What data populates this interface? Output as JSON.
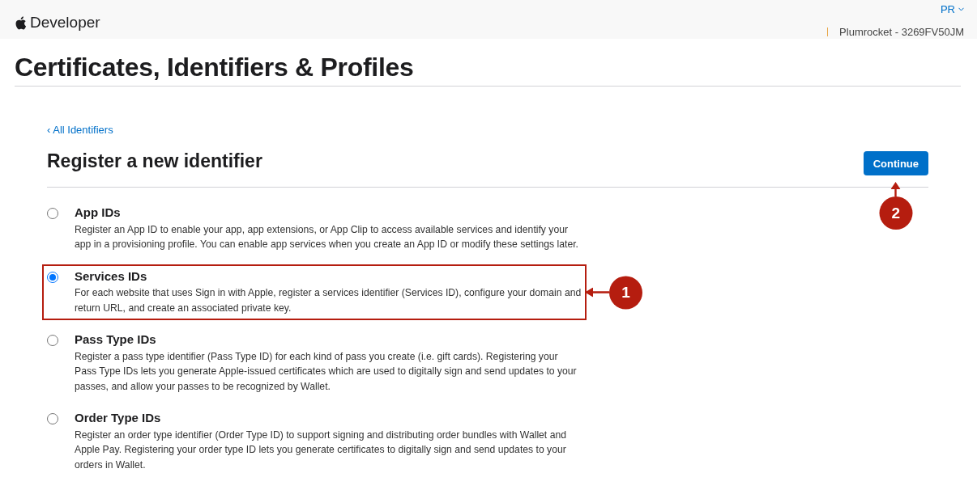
{
  "header": {
    "brand": "Developer",
    "account_initials": "PR",
    "team": "Plumrocket - 3269FV50JM"
  },
  "page_title": "Certificates, Identifiers & Profiles",
  "back_link": "‹ All Identifiers",
  "heading": "Register a new identifier",
  "continue_button": {
    "label": "Continue",
    "callout": "2"
  },
  "options": [
    {
      "title": "App IDs",
      "description": "Register an App ID to enable your app, app extensions, or App Clip to access available services and identify your app in a provisioning profile. You can enable app services when you create an App ID or modify these settings later.",
      "selected": false,
      "highlighted": false
    },
    {
      "title": "Services IDs",
      "description": "For each website that uses Sign in with Apple, register a services identifier (Services ID), configure your domain and return URL, and create an associated private key.",
      "selected": true,
      "highlighted": true,
      "callout": "1"
    },
    {
      "title": "Pass Type IDs",
      "description": "Register a pass type identifier (Pass Type ID) for each kind of pass you create (i.e. gift cards). Registering your Pass Type IDs lets you generate Apple-issued certificates which are used to digitally sign and send updates to your passes, and allow your passes to be recognized by Wallet.",
      "selected": false,
      "highlighted": false
    },
    {
      "title": "Order Type IDs",
      "description": "Register an order type identifier (Order Type ID) to support signing and distributing order bundles with Wallet and Apple Pay. Registering your order type ID lets you generate certificates to digitally sign and send updates to your orders in Wallet.",
      "selected": false,
      "highlighted": false
    }
  ]
}
